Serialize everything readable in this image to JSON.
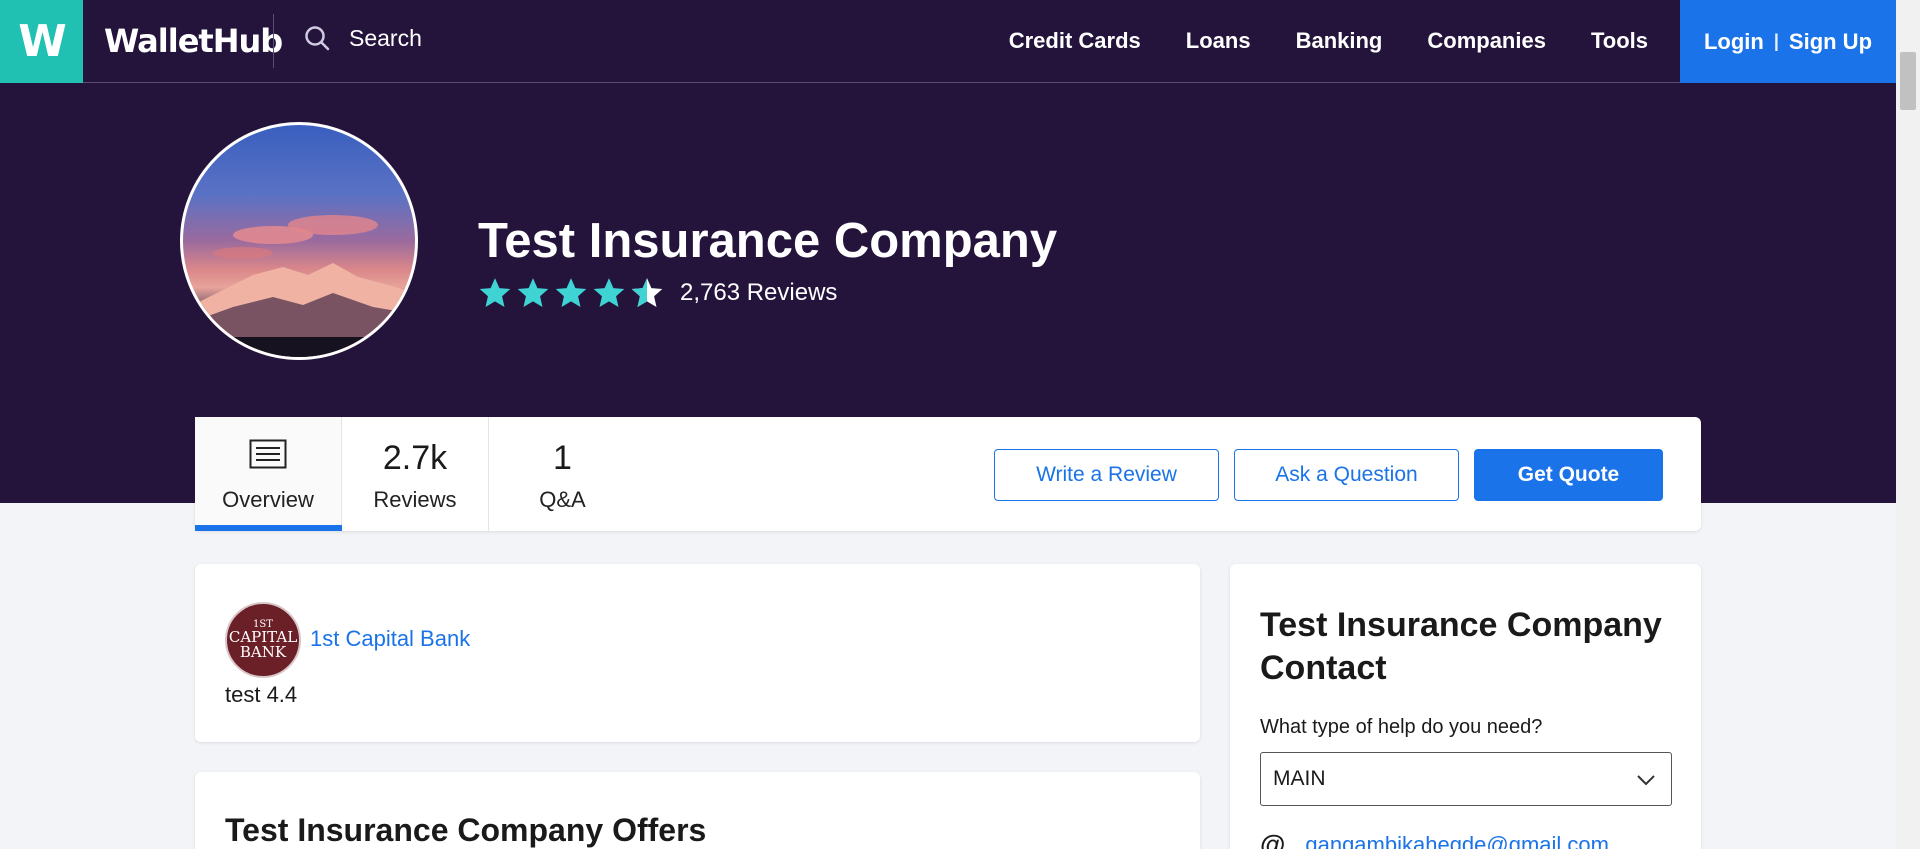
{
  "nav": {
    "logo_letter": "W",
    "brand": "WalletHub",
    "search_label": "Search",
    "links": [
      "Credit Cards",
      "Loans",
      "Banking",
      "Companies",
      "Tools"
    ],
    "login": "Login",
    "signup": "Sign Up"
  },
  "hero": {
    "title": "Test Insurance Company",
    "rating_stars": 4.5,
    "review_count": "2,763 Reviews"
  },
  "tabs": {
    "overview_label": "Overview",
    "reviews_value": "2.7k",
    "reviews_label": "Reviews",
    "qa_value": "1",
    "qa_label": "Q&A"
  },
  "actions": {
    "write_review": "Write a Review",
    "ask_question": "Ask a Question",
    "get_quote": "Get Quote"
  },
  "review_card": {
    "logo_line1": "1ST",
    "logo_line2": "CAPITAL",
    "logo_line3": "BANK",
    "company_name": "1st Capital Bank",
    "text": "test 4.4"
  },
  "offers": {
    "title": "Test Insurance Company Offers"
  },
  "contact": {
    "title": "Test Insurance Company Contact",
    "help_label": "What type of help do you need?",
    "selected_option": "MAIN",
    "email": "gangambikahegde@gmail.com"
  },
  "colors": {
    "nav_bg": "#24143c",
    "accent_teal": "#20c0b2",
    "primary_blue": "#1a73e8",
    "star": "#3fd3d3"
  }
}
